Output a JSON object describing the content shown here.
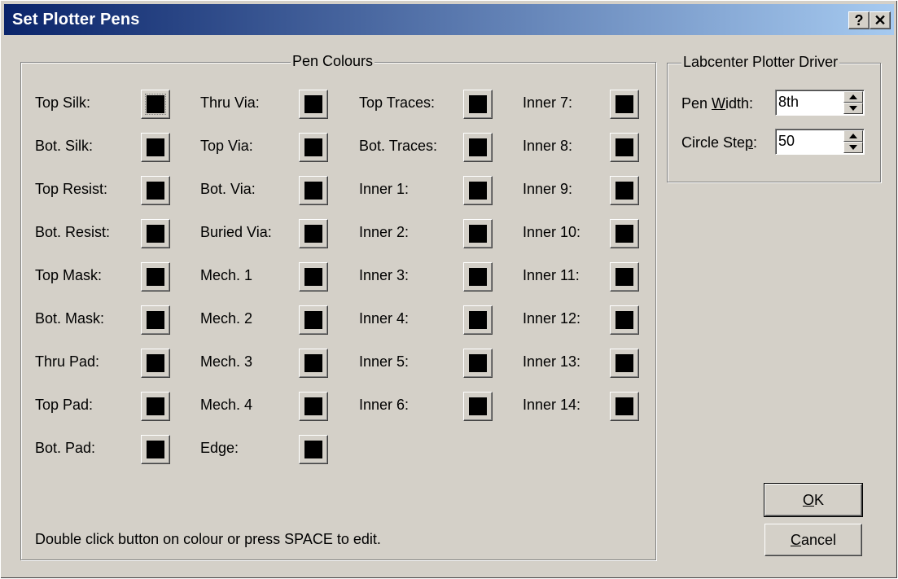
{
  "window": {
    "title": "Set Plotter Pens",
    "help_button": "?",
    "close_button": "✕"
  },
  "pen_colours": {
    "group_label": "Pen Colours",
    "columns": [
      [
        {
          "label": "Top Silk:",
          "color": "#000000",
          "focused": true
        },
        {
          "label": "Bot. Silk:",
          "color": "#000000"
        },
        {
          "label": "Top Resist:",
          "color": "#000000"
        },
        {
          "label": "Bot. Resist:",
          "color": "#000000"
        },
        {
          "label": "Top Mask:",
          "color": "#000000"
        },
        {
          "label": "Bot. Mask:",
          "color": "#000000"
        },
        {
          "label": "Thru Pad:",
          "color": "#000000"
        },
        {
          "label": "Top Pad:",
          "color": "#000000"
        },
        {
          "label": "Bot. Pad:",
          "color": "#000000"
        }
      ],
      [
        {
          "label": "Thru Via:",
          "color": "#000000"
        },
        {
          "label": "Top Via:",
          "color": "#000000"
        },
        {
          "label": "Bot. Via:",
          "color": "#000000"
        },
        {
          "label": "Buried Via:",
          "color": "#000000"
        },
        {
          "label": "Mech. 1",
          "color": "#000000"
        },
        {
          "label": "Mech. 2",
          "color": "#000000"
        },
        {
          "label": "Mech. 3",
          "color": "#000000"
        },
        {
          "label": "Mech. 4",
          "color": "#000000"
        },
        {
          "label": "Edge:",
          "color": "#000000"
        }
      ],
      [
        {
          "label": "Top Traces:",
          "color": "#000000"
        },
        {
          "label": "Bot. Traces:",
          "color": "#000000"
        },
        {
          "label": "Inner 1:",
          "color": "#000000"
        },
        {
          "label": "Inner 2:",
          "color": "#000000"
        },
        {
          "label": "Inner 3:",
          "color": "#000000"
        },
        {
          "label": "Inner 4:",
          "color": "#000000"
        },
        {
          "label": "Inner 5:",
          "color": "#000000"
        },
        {
          "label": "Inner 6:",
          "color": "#000000"
        }
      ],
      [
        {
          "label": "Inner 7:",
          "color": "#000000"
        },
        {
          "label": "Inner 8:",
          "color": "#000000"
        },
        {
          "label": "Inner 9:",
          "color": "#000000"
        },
        {
          "label": "Inner 10:",
          "color": "#000000"
        },
        {
          "label": "Inner 11:",
          "color": "#000000"
        },
        {
          "label": "Inner 12:",
          "color": "#000000"
        },
        {
          "label": "Inner 13:",
          "color": "#000000"
        },
        {
          "label": "Inner 14:",
          "color": "#000000"
        }
      ]
    ],
    "hint": "Double click button on colour or press SPACE to edit."
  },
  "driver": {
    "group_label": "Labcenter Plotter Driver",
    "pen_width": {
      "label_pre": "Pen ",
      "label_accel": "W",
      "label_post": "idth:",
      "value": "8th"
    },
    "circle_step": {
      "label_pre": "Circle Ste",
      "label_accel": "p",
      "label_post": ":",
      "value": "50"
    }
  },
  "buttons": {
    "ok": {
      "accel": "O",
      "rest": "K"
    },
    "cancel": {
      "accel": "C",
      "rest": "ancel"
    }
  }
}
